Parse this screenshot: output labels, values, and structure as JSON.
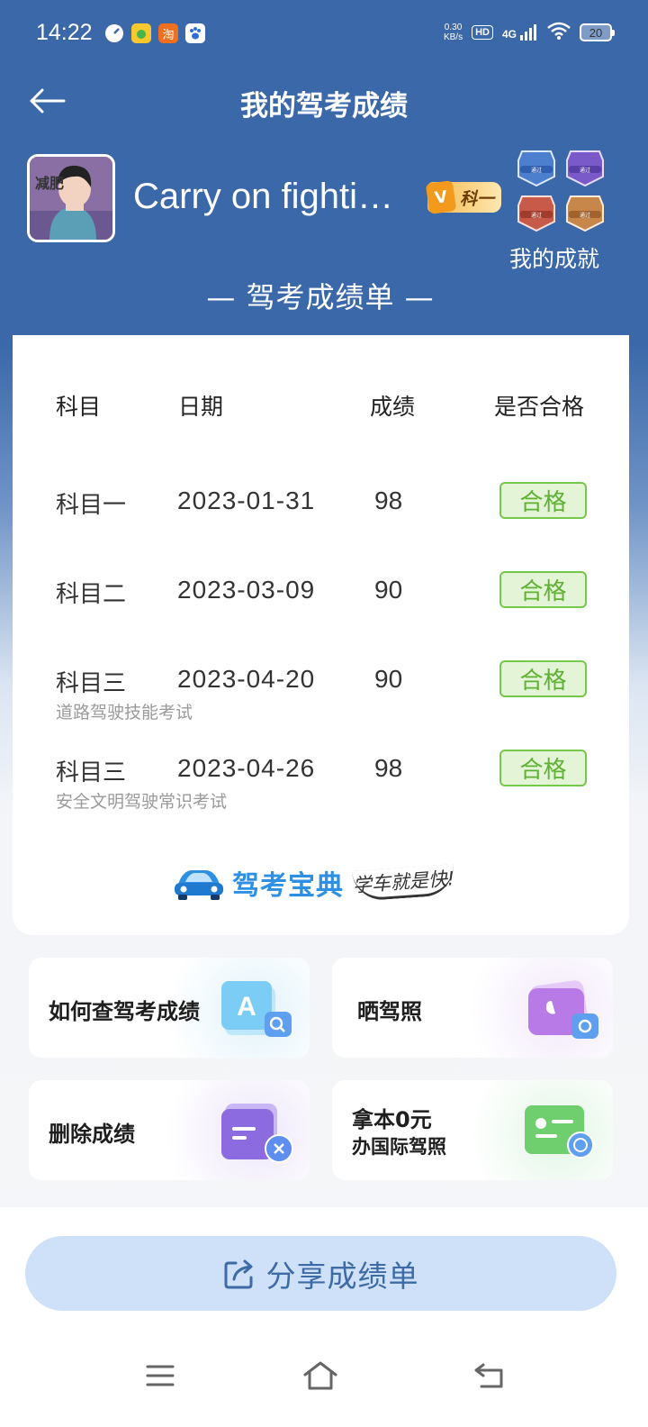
{
  "status_bar": {
    "time": "14:22",
    "app_icons": [
      "timer-icon",
      "music-app-icon",
      "taobao-icon",
      "baidu-icon"
    ],
    "taobao_text": "淘",
    "net_speed_value": "0.30",
    "net_speed_unit": "KB/s",
    "hd": "HD",
    "network": "4G",
    "battery": "20"
  },
  "header": {
    "title": "我的驾考成绩"
  },
  "profile": {
    "avatar_text": "减肥",
    "username": "Carry on fighti…",
    "level_v": "V",
    "level": "科一",
    "achievements_label": "我的成就",
    "medal_texts": [
      "通过",
      "通过",
      "通过",
      "通过"
    ]
  },
  "report": {
    "title": "— 驾考成绩单 —",
    "columns": [
      "科目",
      "日期",
      "成绩",
      "是否合格"
    ],
    "rows": [
      {
        "subject": "科目一",
        "date": "2023-01-31",
        "score": "98",
        "status": "合格",
        "note": ""
      },
      {
        "subject": "科目二",
        "date": "2023-03-09",
        "score": "90",
        "status": "合格",
        "note": ""
      },
      {
        "subject": "科目三",
        "date": "2023-04-20",
        "score": "90",
        "status": "合格",
        "note": "道路驾驶技能考试"
      },
      {
        "subject": "科目三",
        "date": "2023-04-26",
        "score": "98",
        "status": "合格",
        "note": "安全文明驾驶常识考试"
      }
    ],
    "brand_name": "驾考宝典",
    "brand_slogan": "学车就是快!"
  },
  "actions": {
    "query_score": "如何查驾考成绩",
    "show_license": "晒驾照",
    "delete_score": "删除成绩",
    "intl_license_line1": "拿本0元",
    "intl_license_line2": "办国际驾照"
  },
  "share": {
    "label": "分享成绩单"
  },
  "colors": {
    "header_blue": "#3a68a8",
    "pass_green": "#5fb133",
    "share_bg": "#cfe1f8",
    "brand_blue": "#2f8fe3"
  }
}
